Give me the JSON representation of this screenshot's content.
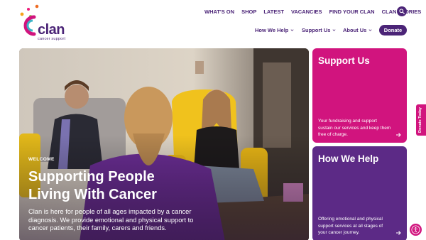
{
  "brand": {
    "name": "clan",
    "tagline": "cancer support",
    "colors": {
      "primary": "#4b2477",
      "magenta": "#d1147e",
      "purple": "#5c2a86"
    }
  },
  "topnav": [
    "WHAT'S ON",
    "SHOP",
    "LATEST",
    "VACANCIES",
    "FIND YOUR CLAN",
    "CLAN STORIES"
  ],
  "mainnav": [
    {
      "label": "How We Help"
    },
    {
      "label": "Support Us"
    },
    {
      "label": "About Us"
    }
  ],
  "donate_label": "Donate",
  "hero": {
    "eyebrow": "WELCOME",
    "title_line1": "Supporting People",
    "title_line2": "Living With Cancer",
    "description": "Clan is here for people of all ages impacted by a cancer diagnosis. We provide emotional and physical support to cancer patients, their family, carers and friends."
  },
  "cards": [
    {
      "title": "Support Us",
      "text": "Your fundraising and support sustain our services and keep them free of charge."
    },
    {
      "title": "How We Help",
      "text": "Offering emotional and physical support services at all stages of your cancer journey."
    }
  ],
  "side_tab": "Donate Today",
  "icons": [
    "logo-dots",
    "search-icon",
    "chevron-down-icon",
    "arrow-right-icon",
    "accessibility-icon"
  ]
}
